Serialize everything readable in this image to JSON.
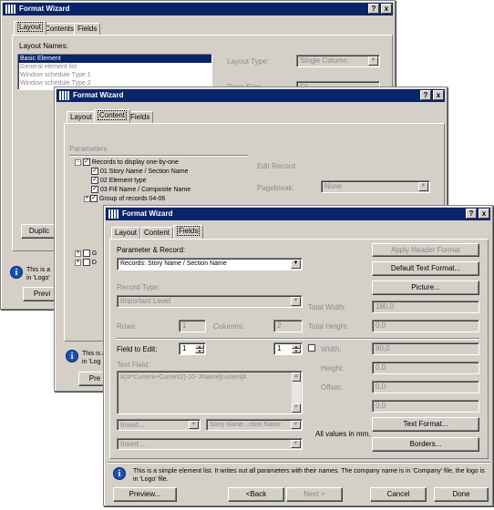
{
  "win1": {
    "title": "Format Wizard",
    "help_label": "?",
    "close_label": "x",
    "tabs": [
      "Layout",
      "Contents",
      "Fields"
    ],
    "layout_names_label": "Layout Names:",
    "layout_names": [
      "Basic Element",
      "General element list",
      "Window schedule Type 1",
      "Window schedule Type 2"
    ],
    "layout_type_label": "Layout Type:",
    "layout_type_value": "Single Column",
    "page_size_label": "Page Size:",
    "page_size_value": "Fit",
    "duplicate_label": "Duplic",
    "info_text": "This is a",
    "info_text2": "in 'Logo'",
    "preview_label": "Previ"
  },
  "win2": {
    "title": "Format Wizard",
    "help_label": "?",
    "close_label": "x",
    "tabs": [
      "Layout",
      "Content",
      "Fields"
    ],
    "parameters_label": "Parameters",
    "tree": [
      {
        "text": "Records to display one-by-one",
        "level": 0,
        "expander": "-"
      },
      {
        "text": "01 Story Name / Section Name",
        "level": 1,
        "expander": ""
      },
      {
        "text": "02 Element type",
        "level": 1,
        "expander": ""
      },
      {
        "text": "03 Fill Name / Composite Name",
        "level": 1,
        "expander": ""
      },
      {
        "text": "Group of records 04-06",
        "level": 1,
        "expander": "+"
      }
    ],
    "tree_bottom": [
      {
        "text": "G",
        "expander": "+"
      },
      {
        "text": "D",
        "expander": "+"
      }
    ],
    "edit_record_label": "Edit Record:",
    "pagebreak_label": "Pagebreak:",
    "pagebreak_value": "None",
    "info_text": "This is a",
    "info_text2": "in 'Log",
    "preview_label": "Pre"
  },
  "win3": {
    "title": "Format Wizard",
    "help_label": "?",
    "close_label": "x",
    "tabs": [
      "Layout",
      "Content",
      "Fields"
    ],
    "parameter_record_label": "Parameter & Record:",
    "parameter_record_value": "Records: Story Name / Section Name",
    "apply_header_label": "Apply Header Format",
    "default_text_label": "Default Text Format...",
    "picture_label": "Picture...",
    "record_type_label": "Record Type:",
    "record_type_value": "Important Level",
    "total_width_label": "Total Width:",
    "total_width_value": "180,0",
    "rows_label": "Rows:",
    "rows_value": "1",
    "columns_label": "Columns:",
    "columns_value": "2",
    "total_height_label": "Total Height:",
    "total_height_value": "0,0",
    "field_to_edit_label": "Field to Edit:",
    "field_left_value": "1",
    "field_right_value": "1",
    "width_label": "Width:",
    "width_value": "80,0",
    "height_label": "Height:",
    "height_value": "0,0",
    "offset_label": "Offset:",
    "offset_value": "0,0",
    "extra_value": "0,0",
    "text_field_label": "Text Field:",
    "text_field_value": "#(!#*Current+Current2)-10- #Name[current]#",
    "insert_label": "Insert...",
    "story_name_value": "Story Name...ction Name",
    "insert2_label": "Insert...",
    "all_values_label": "All values in mm.",
    "text_format_label": "Text Format...",
    "borders_label": "Borders...",
    "info_text": "This is a simple element list. It writes out all parameters with their names. The company name is in 'Company' file, the logo is in 'Logo' file.",
    "preview_label": "Preview...",
    "back_label": "<Back",
    "next_label": "Next >",
    "cancel_label": "Cancel",
    "done_label": "Done"
  }
}
